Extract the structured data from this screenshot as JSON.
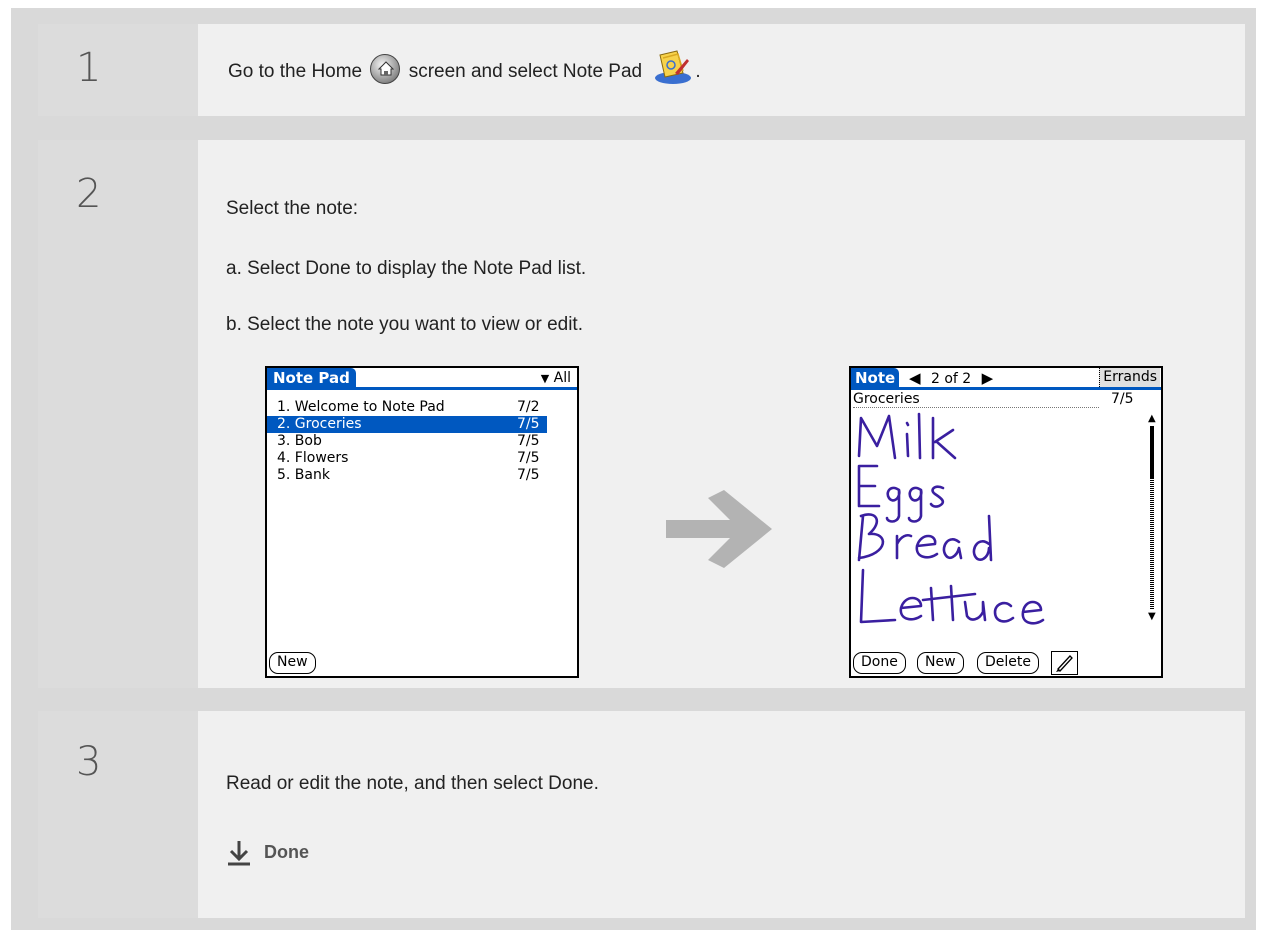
{
  "steps": [
    {
      "number": "1",
      "text_before": "Go to the Home",
      "home_icon": "home-icon",
      "text_middle": "screen and select Note Pad",
      "notepad_icon": "notepad-app-icon",
      "text_after": "."
    },
    {
      "number": "2",
      "intro": "Select the note:",
      "sub_a": "a.  Select Done to display the Note Pad list.",
      "sub_b": "b.  Select the note you want to view or edit."
    },
    {
      "number": "3",
      "text": "Read or edit the note, and then select Done.",
      "done_link": "Done",
      "done_icon": "down-arrow-icon"
    }
  ],
  "list_screen": {
    "title": "Note Pad",
    "category": "All",
    "notes": [
      {
        "title": "1. Welcome to Note Pad",
        "date": "7/2",
        "selected": false
      },
      {
        "title": "2. Groceries",
        "date": "7/5",
        "selected": true
      },
      {
        "title": "3. Bob",
        "date": "7/5",
        "selected": false
      },
      {
        "title": "4. Flowers",
        "date": "7/5",
        "selected": false
      },
      {
        "title": "5. Bank",
        "date": "7/5",
        "selected": false
      }
    ],
    "new_button": "New"
  },
  "note_screen": {
    "title": "Note",
    "page_indicator": "2 of 2",
    "category": "Errands",
    "note_title": "Groceries",
    "note_date": "7/5",
    "handwritten_lines": [
      "Milk",
      "Eggs",
      "Bread",
      "Lettuce"
    ],
    "buttons": {
      "done": "Done",
      "new": "New",
      "delete": "Delete"
    },
    "pen_icon": "pen-color-icon"
  },
  "colors": {
    "palm_blue": "#0058c0",
    "ink": "#3a1fa0",
    "arrow": "#b3b3b3"
  }
}
